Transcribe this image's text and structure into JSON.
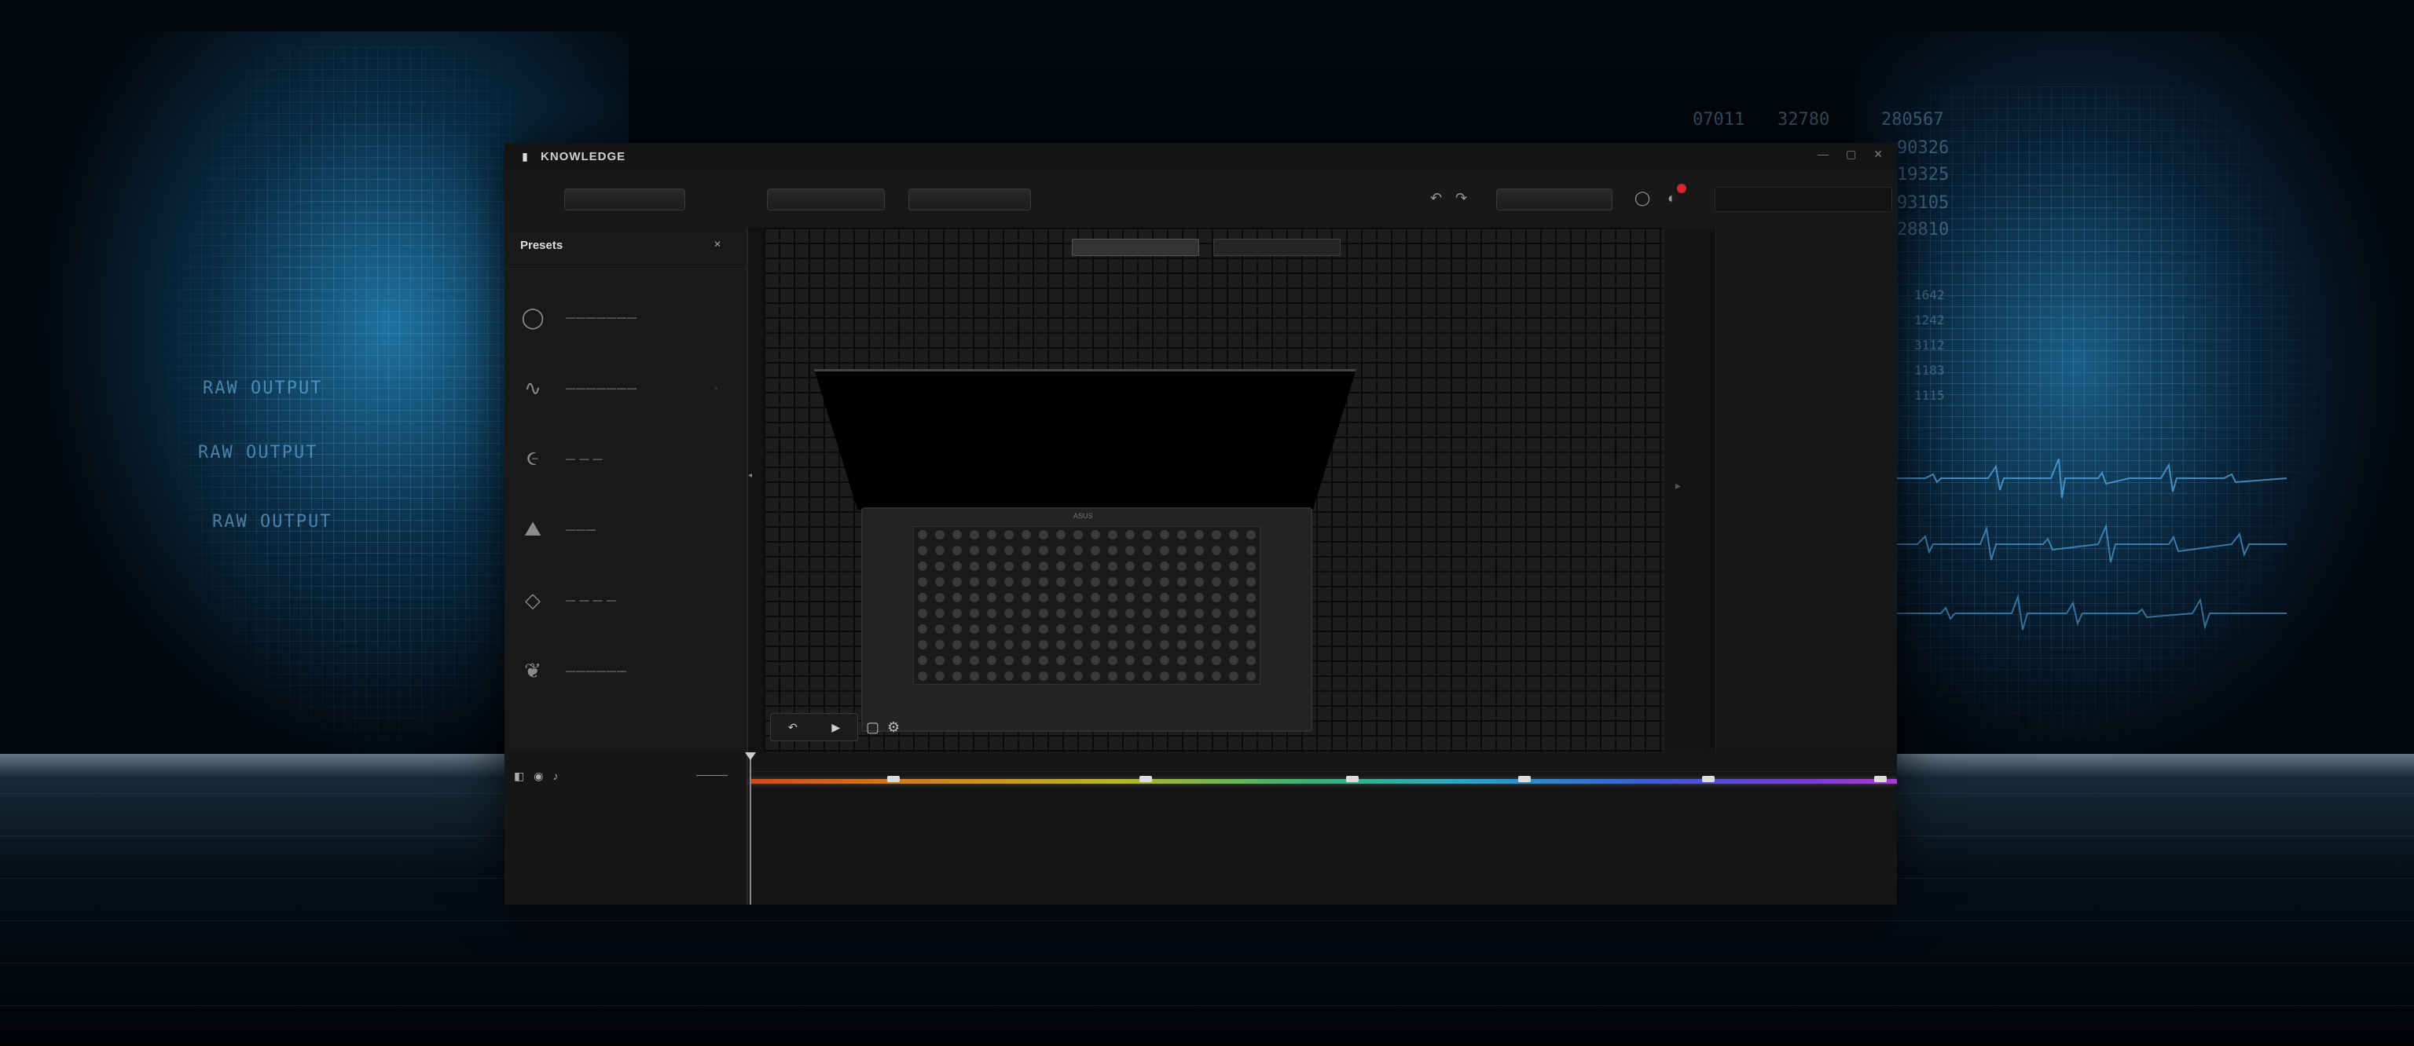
{
  "background": {
    "left_labels": [
      "RAW OUTPUT",
      "RAW OUTPUT",
      "RAW OUTPUT"
    ],
    "right_numbers": [
      "07011",
      "32780",
      "280567",
      "90326",
      "19325",
      "93105",
      "28810"
    ],
    "right_small": [
      "1642",
      "1242",
      "3112",
      "1183",
      "1115"
    ],
    "accent": "#2c9bd6"
  },
  "window": {
    "title": "KNOWLEDGE",
    "controls": [
      "—",
      "▢",
      "✕"
    ]
  },
  "toolbar": {
    "buttons": [
      "",
      "",
      ""
    ],
    "right_button": "",
    "search_placeholder": "",
    "notification_color": "#d8262a"
  },
  "left_panel": {
    "header": "Presets",
    "close": "✕",
    "tools": [
      {
        "icon": "circle-icon",
        "glyph": "◯",
        "label": "———————"
      },
      {
        "icon": "wave-icon",
        "glyph": "∿",
        "label": "———————"
      },
      {
        "icon": "spiral-icon",
        "glyph": "૯",
        "label": "— — —"
      },
      {
        "icon": "mountain-icon",
        "glyph": "⛰",
        "label": "———"
      },
      {
        "icon": "diamond-icon",
        "glyph": "◇",
        "label": "— — — —"
      },
      {
        "icon": "leaf-icon",
        "glyph": "❦",
        "label": "——————"
      }
    ]
  },
  "viewport": {
    "tabs": [
      "",
      ""
    ],
    "laptop_brand": "ASUS",
    "controls": [
      "↶",
      "▶"
    ]
  },
  "timeline": {
    "label": "————",
    "spectrum_colors": [
      "#d14a1d",
      "#d1821d",
      "#b8b52a",
      "#3db36f",
      "#2aa8c4",
      "#3a5ed6",
      "#7a3bd6"
    ]
  }
}
